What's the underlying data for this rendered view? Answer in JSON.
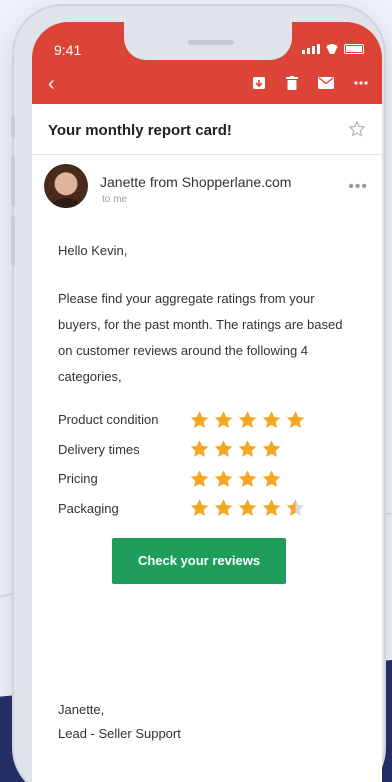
{
  "status_bar": {
    "time": "9:41"
  },
  "email": {
    "subject": "Your monthly report card!",
    "sender": "Janette from Shopperlane.com",
    "recipient": "to me",
    "greeting": "Hello Kevin,",
    "paragraph": "Please find your aggregate ratings from your buyers, for the past month. The ratings are based on customer reviews around the following 4 categories,",
    "ratings": [
      {
        "label": "Product condition",
        "stars": 5
      },
      {
        "label": "Delivery times",
        "stars": 4
      },
      {
        "label": "Pricing",
        "stars": 4
      },
      {
        "label": "Packaging",
        "stars": 4.5
      }
    ],
    "cta_label": "Check your reviews",
    "signature_name": "Janette,",
    "signature_role": "Lead - Seller Support"
  },
  "colors": {
    "header": "#db4437",
    "cta": "#1e9e5a",
    "star": "#f5a623"
  },
  "icons": [
    "back-arrow-icon",
    "archive-icon",
    "trash-icon",
    "mail-icon",
    "more-icon",
    "star-outline-icon"
  ]
}
